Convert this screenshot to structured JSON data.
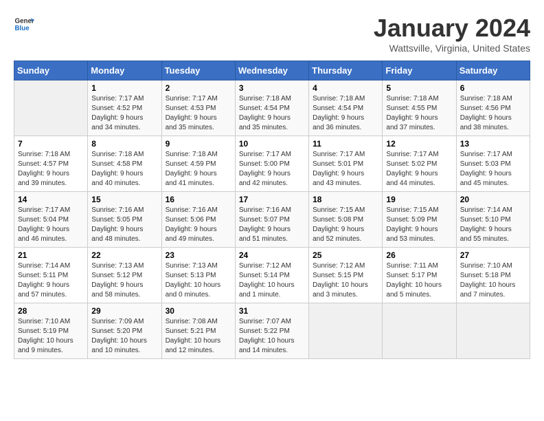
{
  "app": {
    "name_general": "General",
    "name_blue": "Blue"
  },
  "header": {
    "title": "January 2024",
    "subtitle": "Wattsville, Virginia, United States"
  },
  "calendar": {
    "days_of_week": [
      "Sunday",
      "Monday",
      "Tuesday",
      "Wednesday",
      "Thursday",
      "Friday",
      "Saturday"
    ],
    "weeks": [
      [
        {
          "day": "",
          "info": ""
        },
        {
          "day": "1",
          "info": "Sunrise: 7:17 AM\nSunset: 4:52 PM\nDaylight: 9 hours\nand 34 minutes."
        },
        {
          "day": "2",
          "info": "Sunrise: 7:17 AM\nSunset: 4:53 PM\nDaylight: 9 hours\nand 35 minutes."
        },
        {
          "day": "3",
          "info": "Sunrise: 7:18 AM\nSunset: 4:54 PM\nDaylight: 9 hours\nand 35 minutes."
        },
        {
          "day": "4",
          "info": "Sunrise: 7:18 AM\nSunset: 4:54 PM\nDaylight: 9 hours\nand 36 minutes."
        },
        {
          "day": "5",
          "info": "Sunrise: 7:18 AM\nSunset: 4:55 PM\nDaylight: 9 hours\nand 37 minutes."
        },
        {
          "day": "6",
          "info": "Sunrise: 7:18 AM\nSunset: 4:56 PM\nDaylight: 9 hours\nand 38 minutes."
        }
      ],
      [
        {
          "day": "7",
          "info": "Sunrise: 7:18 AM\nSunset: 4:57 PM\nDaylight: 9 hours\nand 39 minutes."
        },
        {
          "day": "8",
          "info": "Sunrise: 7:18 AM\nSunset: 4:58 PM\nDaylight: 9 hours\nand 40 minutes."
        },
        {
          "day": "9",
          "info": "Sunrise: 7:18 AM\nSunset: 4:59 PM\nDaylight: 9 hours\nand 41 minutes."
        },
        {
          "day": "10",
          "info": "Sunrise: 7:17 AM\nSunset: 5:00 PM\nDaylight: 9 hours\nand 42 minutes."
        },
        {
          "day": "11",
          "info": "Sunrise: 7:17 AM\nSunset: 5:01 PM\nDaylight: 9 hours\nand 43 minutes."
        },
        {
          "day": "12",
          "info": "Sunrise: 7:17 AM\nSunset: 5:02 PM\nDaylight: 9 hours\nand 44 minutes."
        },
        {
          "day": "13",
          "info": "Sunrise: 7:17 AM\nSunset: 5:03 PM\nDaylight: 9 hours\nand 45 minutes."
        }
      ],
      [
        {
          "day": "14",
          "info": "Sunrise: 7:17 AM\nSunset: 5:04 PM\nDaylight: 9 hours\nand 46 minutes."
        },
        {
          "day": "15",
          "info": "Sunrise: 7:16 AM\nSunset: 5:05 PM\nDaylight: 9 hours\nand 48 minutes."
        },
        {
          "day": "16",
          "info": "Sunrise: 7:16 AM\nSunset: 5:06 PM\nDaylight: 9 hours\nand 49 minutes."
        },
        {
          "day": "17",
          "info": "Sunrise: 7:16 AM\nSunset: 5:07 PM\nDaylight: 9 hours\nand 51 minutes."
        },
        {
          "day": "18",
          "info": "Sunrise: 7:15 AM\nSunset: 5:08 PM\nDaylight: 9 hours\nand 52 minutes."
        },
        {
          "day": "19",
          "info": "Sunrise: 7:15 AM\nSunset: 5:09 PM\nDaylight: 9 hours\nand 53 minutes."
        },
        {
          "day": "20",
          "info": "Sunrise: 7:14 AM\nSunset: 5:10 PM\nDaylight: 9 hours\nand 55 minutes."
        }
      ],
      [
        {
          "day": "21",
          "info": "Sunrise: 7:14 AM\nSunset: 5:11 PM\nDaylight: 9 hours\nand 57 minutes."
        },
        {
          "day": "22",
          "info": "Sunrise: 7:13 AM\nSunset: 5:12 PM\nDaylight: 9 hours\nand 58 minutes."
        },
        {
          "day": "23",
          "info": "Sunrise: 7:13 AM\nSunset: 5:13 PM\nDaylight: 10 hours\nand 0 minutes."
        },
        {
          "day": "24",
          "info": "Sunrise: 7:12 AM\nSunset: 5:14 PM\nDaylight: 10 hours\nand 1 minute."
        },
        {
          "day": "25",
          "info": "Sunrise: 7:12 AM\nSunset: 5:15 PM\nDaylight: 10 hours\nand 3 minutes."
        },
        {
          "day": "26",
          "info": "Sunrise: 7:11 AM\nSunset: 5:17 PM\nDaylight: 10 hours\nand 5 minutes."
        },
        {
          "day": "27",
          "info": "Sunrise: 7:10 AM\nSunset: 5:18 PM\nDaylight: 10 hours\nand 7 minutes."
        }
      ],
      [
        {
          "day": "28",
          "info": "Sunrise: 7:10 AM\nSunset: 5:19 PM\nDaylight: 10 hours\nand 9 minutes."
        },
        {
          "day": "29",
          "info": "Sunrise: 7:09 AM\nSunset: 5:20 PM\nDaylight: 10 hours\nand 10 minutes."
        },
        {
          "day": "30",
          "info": "Sunrise: 7:08 AM\nSunset: 5:21 PM\nDaylight: 10 hours\nand 12 minutes."
        },
        {
          "day": "31",
          "info": "Sunrise: 7:07 AM\nSunset: 5:22 PM\nDaylight: 10 hours\nand 14 minutes."
        },
        {
          "day": "",
          "info": ""
        },
        {
          "day": "",
          "info": ""
        },
        {
          "day": "",
          "info": ""
        }
      ]
    ]
  }
}
